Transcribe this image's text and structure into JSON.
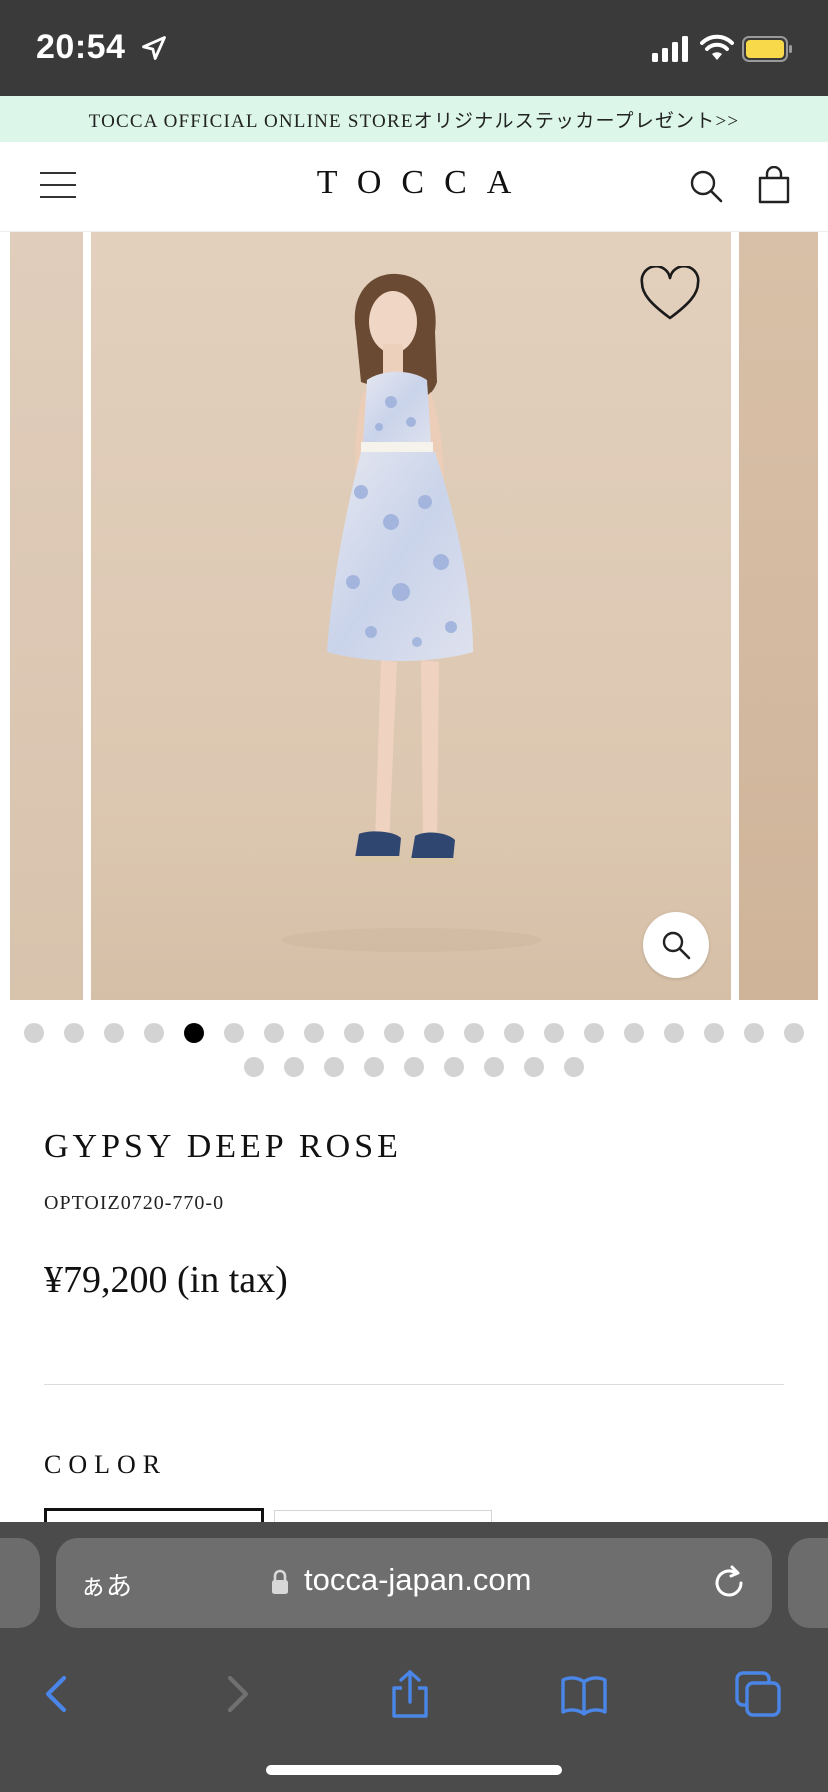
{
  "status_bar": {
    "time": "20:54",
    "icons": [
      "location-arrow-icon",
      "cellular-signal-icon",
      "wifi-icon",
      "battery-icon"
    ],
    "battery_color": "#f7d94a"
  },
  "promo_banner": {
    "text": "TOCCA OFFICIAL ONLINE STOREオリジナルステッカープレゼント>>",
    "background": "#dcf6ea"
  },
  "header": {
    "logo": "TOCCA",
    "icons": [
      "hamburger-menu-icon",
      "search-icon",
      "shopping-bag-icon"
    ]
  },
  "gallery": {
    "image_subject": "model wearing floral lace sleeveless dress with navy bow sandals",
    "favorite_icon": "heart-outline-icon",
    "zoom_icon": "zoom-magnifier-icon",
    "total_images": 29,
    "active_index": 5
  },
  "product": {
    "name": "GYPSY DEEP ROSE",
    "code": "OPTOIZ0720-770-0",
    "price": "¥79,200 (in tax)"
  },
  "color_section": {
    "label": "COLOR"
  },
  "safari": {
    "aa_label": "ぁあ",
    "url": "tocca-japan.com",
    "accent_color": "#4a86e8",
    "toolbar_icons": [
      "back-icon",
      "forward-icon",
      "share-icon",
      "bookmarks-icon",
      "tabs-icon"
    ]
  }
}
